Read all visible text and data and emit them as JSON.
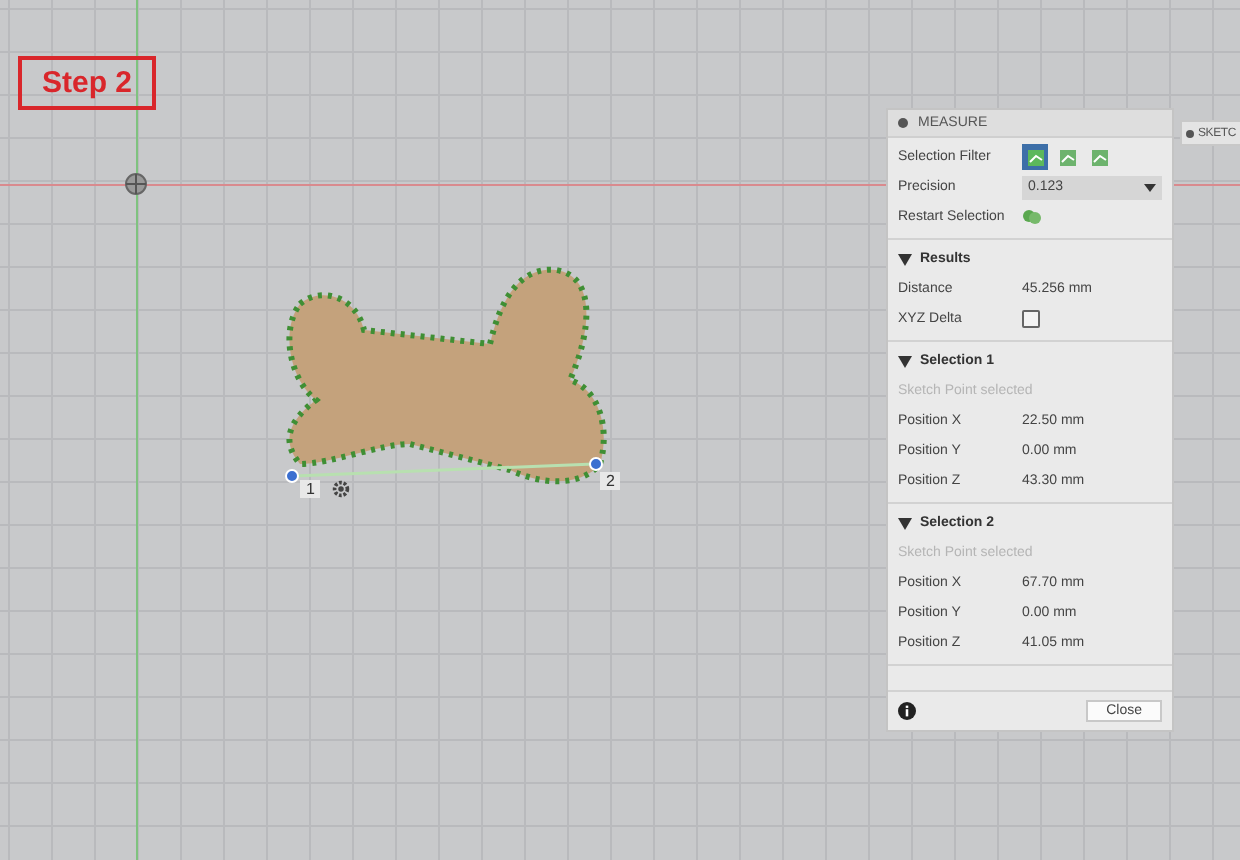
{
  "step_label": "Step 2",
  "point_labels": [
    "1",
    "2"
  ],
  "measure": {
    "title": "MEASURE",
    "selection_filter": {
      "label": "Selection Filter",
      "filters": [
        {
          "selected": true
        },
        {
          "selected": false
        },
        {
          "selected": false
        }
      ]
    },
    "precision": {
      "label": "Precision",
      "value": "0.123"
    },
    "restart": {
      "label": "Restart Selection"
    },
    "sections": [
      {
        "title": "Results",
        "expanded": true,
        "rows": [
          {
            "kind": "value",
            "label": "Distance",
            "value": "45.256 mm"
          },
          {
            "kind": "checkbox",
            "label": "XYZ Delta",
            "checked": false
          }
        ]
      },
      {
        "title": "Selection 1",
        "expanded": true,
        "hint": "Sketch Point selected",
        "rows": [
          {
            "kind": "value",
            "label": "Position X",
            "value": "22.50 mm"
          },
          {
            "kind": "value",
            "label": "Position Y",
            "value": "0.00 mm"
          },
          {
            "kind": "value",
            "label": "Position Z",
            "value": "43.30 mm"
          }
        ]
      },
      {
        "title": "Selection 2",
        "expanded": true,
        "hint": "Sketch Point selected",
        "rows": [
          {
            "kind": "value",
            "label": "Position X",
            "value": "67.70 mm"
          },
          {
            "kind": "value",
            "label": "Position Y",
            "value": "0.00 mm"
          },
          {
            "kind": "value",
            "label": "Position Z",
            "value": "41.05 mm"
          }
        ]
      }
    ],
    "close_button": "Close"
  },
  "sketch_tab": "SKETC"
}
